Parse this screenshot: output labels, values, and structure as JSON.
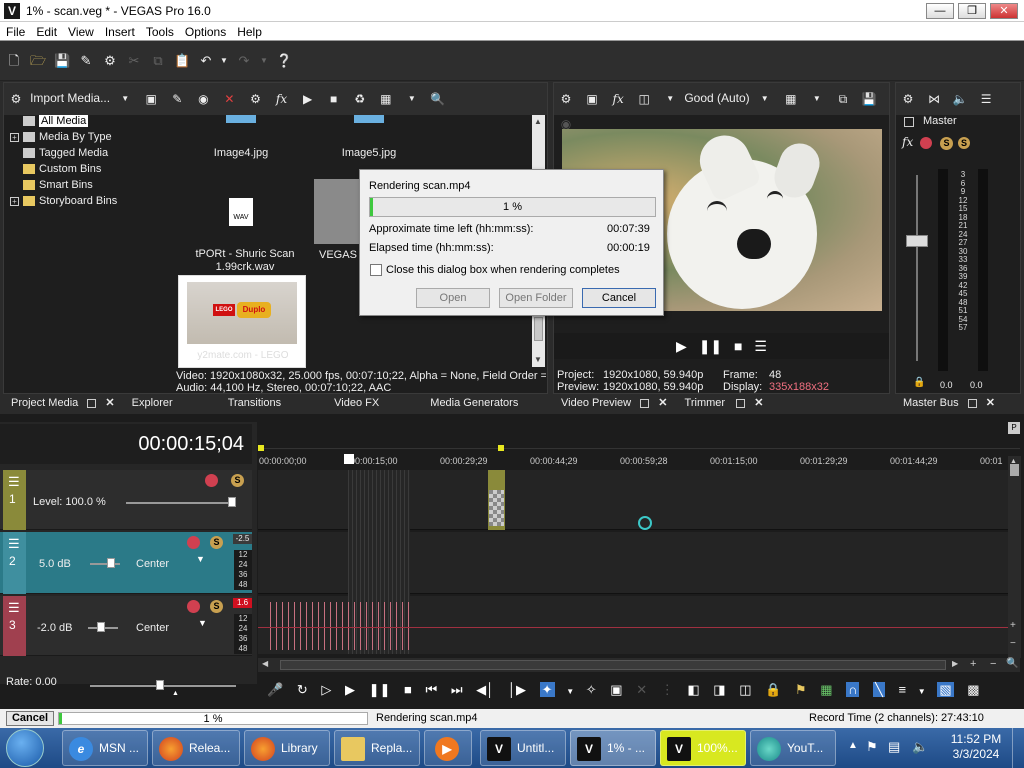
{
  "window": {
    "title": "1% - scan.veg * - VEGAS Pro 16.0",
    "app_icon": "V"
  },
  "menu": [
    "File",
    "Edit",
    "View",
    "Insert",
    "Tools",
    "Options",
    "Help"
  ],
  "media_panel": {
    "import_label": "Import Media...",
    "tree": [
      "All Media",
      "Media By Type",
      "Tagged Media",
      "Custom Bins",
      "Smart Bins",
      "Storyboard Bins"
    ],
    "thumbs": [
      {
        "caption": "Image4.jpg"
      },
      {
        "caption": "Image5.jpg"
      },
      {
        "caption": "tPORt - Shuric Scan 1.99crk.wav",
        "badge": "WAV"
      },
      {
        "caption": "VEGAS S"
      },
      {
        "caption": "y2mate.com - LEGO",
        "brand_a": "LEGO",
        "brand_b": "Duplo"
      }
    ],
    "info_line1": "Video: 1920x1080x32, 25.000 fps, 00:07:10;22, Alpha = None, Field Order =",
    "info_line2": "Audio: 44,100 Hz, Stereo, 00:07:10;22, AAC",
    "tabs": [
      "Project Media",
      "Explorer",
      "Transitions",
      "Video FX",
      "Media Generators"
    ]
  },
  "preview": {
    "quality": "Good (Auto)",
    "project_label": "Project:",
    "project_value": "1920x1080, 59.940p",
    "preview_label": "Preview:",
    "preview_value": "1920x1080, 59.940p",
    "frame_label": "Frame:",
    "frame_value": "48",
    "display_label": "Display:",
    "display_value": "335x188x32",
    "tabs": [
      "Video Preview",
      "Trimmer"
    ]
  },
  "master": {
    "label": "Master",
    "scale": [
      "3",
      "6",
      "9",
      "12",
      "15",
      "18",
      "21",
      "24",
      "27",
      "30",
      "33",
      "36",
      "39",
      "42",
      "45",
      "48",
      "51",
      "54",
      "57"
    ],
    "left_value": "0.0",
    "right_value": "0.0",
    "tab": "Master Bus"
  },
  "render_dialog": {
    "title": "Rendering scan.mp4",
    "progress": 0.01,
    "progress_text": "1 %",
    "time_left_label": "Approximate time left (hh:mm:ss):",
    "time_left": "00:07:39",
    "elapsed_label": "Elapsed time (hh:mm:ss):",
    "elapsed": "00:00:19",
    "checkbox_label": "Close this dialog box when rendering completes",
    "open": "Open",
    "open_folder": "Open Folder",
    "cancel": "Cancel"
  },
  "timeline": {
    "timecode": "00:00:15;04",
    "ruler": [
      "00:00:00;00",
      "00:00:15;00",
      "00:00:29;29",
      "00:00:44;29",
      "00:00:59;28",
      "00:01:15;00",
      "00:01:29;29",
      "00:01:44;29",
      "00:01"
    ],
    "tracks": [
      {
        "num": "1",
        "label": "Level: 100.0 %",
        "color": "#8a8a3a"
      },
      {
        "num": "2",
        "vol": "5.0 dB",
        "pan": "Center",
        "peak": "-2.5",
        "meter": [
          "12",
          "24",
          "36",
          "48"
        ],
        "color": "#3f8f9f"
      },
      {
        "num": "3",
        "vol": "-2.0 dB",
        "pan": "Center",
        "peak": "1.6",
        "meter": [
          "12",
          "24",
          "36",
          "48"
        ],
        "color": "#a0404f"
      }
    ],
    "rate": "Rate: 0.00"
  },
  "status": {
    "cancel": "Cancel",
    "progress_text": "1 %",
    "progress": 0.01,
    "rendering": "Rendering scan.mp4",
    "record_time": "Record Time (2 channels): 27:43:10"
  },
  "taskbar": {
    "items": [
      {
        "label": "MSN ...",
        "icon": "e"
      },
      {
        "label": "Relea...",
        "icon": "ff"
      },
      {
        "label": "Library",
        "icon": "ff"
      },
      {
        "label": "Repla...",
        "icon": "folder"
      },
      {
        "label": "",
        "icon": "media"
      },
      {
        "label": "Untitl...",
        "icon": "V"
      },
      {
        "label": "1% - ...",
        "icon": "V"
      },
      {
        "label": "100%...",
        "icon": "V"
      },
      {
        "label": "YouT...",
        "icon": "globe"
      }
    ],
    "time": "11:52 PM",
    "date": "3/3/2024"
  }
}
